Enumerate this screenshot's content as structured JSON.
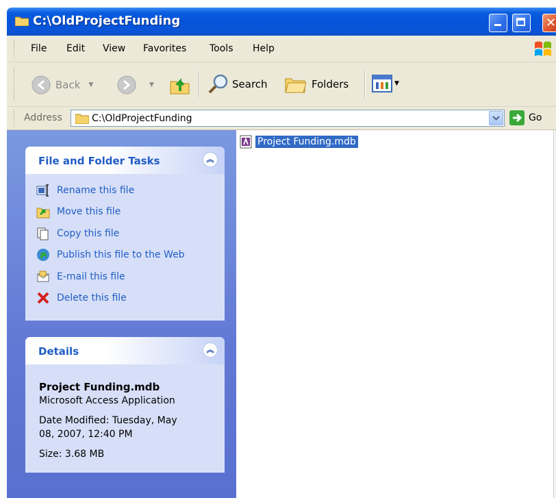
{
  "window": {
    "title": "C:\\OldProjectFunding"
  },
  "menu": [
    "File",
    "Edit",
    "View",
    "Favorites",
    "Tools",
    "Help"
  ],
  "toolbar": {
    "back_label": "Back",
    "search_label": "Search",
    "folders_label": "Folders"
  },
  "address": {
    "label": "Address",
    "value": "C:\\OldProjectFunding",
    "go_label": "Go"
  },
  "tasks_panel": {
    "title": "File and Folder Tasks",
    "items": [
      {
        "label": "Rename this file",
        "icon": "rename-icon"
      },
      {
        "label": "Move this file",
        "icon": "move-icon"
      },
      {
        "label": "Copy this file",
        "icon": "copy-icon"
      },
      {
        "label": "Publish this file to the Web",
        "icon": "globe-icon"
      },
      {
        "label": "E-mail this file",
        "icon": "email-icon"
      },
      {
        "label": "Delete this file",
        "icon": "delete-icon"
      }
    ]
  },
  "details_panel": {
    "title": "Details",
    "file_name": "Project Funding.mdb",
    "file_type": "Microsoft Access Application",
    "date_line1": "Date Modified: Tuesday, May",
    "date_line2": "08, 2007, 12:40 PM",
    "size": "Size: 3.68 MB"
  },
  "files": [
    {
      "name": "Project Funding.mdb",
      "selected": true
    }
  ],
  "colors": {
    "titlebar": "#0453d8",
    "task_link": "#215dc6",
    "selection": "#316ac5",
    "left_pane": "#6b86d8"
  }
}
